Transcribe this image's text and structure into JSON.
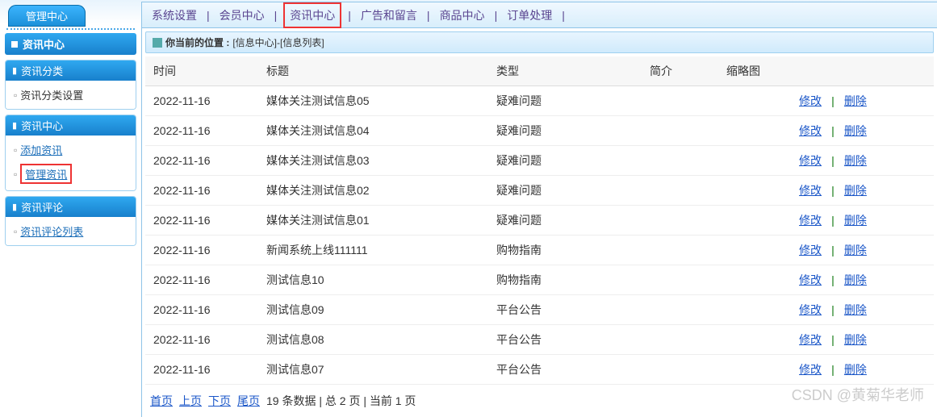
{
  "sidebar": {
    "top_tab": "管理中心",
    "main_header": "资讯中心",
    "groups": [
      {
        "title": "资讯分类",
        "items": [
          {
            "label": "资讯分类设置",
            "underline": false,
            "highlight": false
          }
        ]
      },
      {
        "title": "资讯中心",
        "items": [
          {
            "label": "添加资讯",
            "underline": true,
            "highlight": false
          },
          {
            "label": "管理资讯",
            "underline": true,
            "highlight": true
          }
        ]
      },
      {
        "title": "资讯评论",
        "items": [
          {
            "label": "资讯评论列表",
            "underline": true,
            "highlight": false
          }
        ]
      }
    ]
  },
  "topnav": {
    "items": [
      {
        "label": "系统设置",
        "boxed": false
      },
      {
        "label": "会员中心",
        "boxed": false
      },
      {
        "label": "资讯中心",
        "boxed": true
      },
      {
        "label": "广告和留言",
        "boxed": false
      },
      {
        "label": "商品中心",
        "boxed": false
      },
      {
        "label": "订单处理",
        "boxed": false
      }
    ]
  },
  "breadcrumb": {
    "label": "你当前的位置 :",
    "path": "[信息中心]-[信息列表]"
  },
  "table": {
    "headers": {
      "time": "时间",
      "title": "标题",
      "type": "类型",
      "intro": "简介",
      "thumb": "缩略图",
      "actions": ""
    },
    "action_edit": "修改",
    "action_delete": "删除",
    "rows": [
      {
        "time": "2022-11-16",
        "title": "媒体关注测试信息05",
        "type": "疑难问题",
        "intro": "",
        "thumb": ""
      },
      {
        "time": "2022-11-16",
        "title": "媒体关注测试信息04",
        "type": "疑难问题",
        "intro": "",
        "thumb": ""
      },
      {
        "time": "2022-11-16",
        "title": "媒体关注测试信息03",
        "type": "疑难问题",
        "intro": "",
        "thumb": ""
      },
      {
        "time": "2022-11-16",
        "title": "媒体关注测试信息02",
        "type": "疑难问题",
        "intro": "",
        "thumb": ""
      },
      {
        "time": "2022-11-16",
        "title": "媒体关注测试信息01",
        "type": "疑难问题",
        "intro": "",
        "thumb": ""
      },
      {
        "time": "2022-11-16",
        "title": "新闻系统上线111111",
        "type": "购物指南",
        "intro": "",
        "thumb": ""
      },
      {
        "time": "2022-11-16",
        "title": "测试信息10",
        "type": "购物指南",
        "intro": "",
        "thumb": ""
      },
      {
        "time": "2022-11-16",
        "title": "测试信息09",
        "type": "平台公告",
        "intro": "",
        "thumb": ""
      },
      {
        "time": "2022-11-16",
        "title": "测试信息08",
        "type": "平台公告",
        "intro": "",
        "thumb": ""
      },
      {
        "time": "2022-11-16",
        "title": "测试信息07",
        "type": "平台公告",
        "intro": "",
        "thumb": ""
      }
    ]
  },
  "pager": {
    "first": "首页",
    "prev": "上页",
    "next": "下页",
    "last": "尾页",
    "summary": "19 条数据 | 总 2 页 | 当前 1 页"
  },
  "watermark": "CSDN @黄菊华老师"
}
